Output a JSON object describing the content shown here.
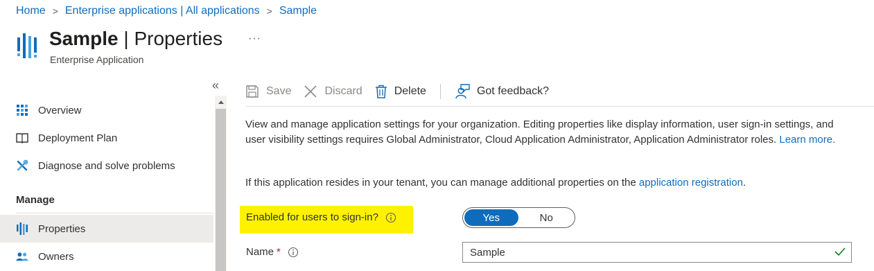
{
  "breadcrumb": {
    "items": [
      "Home",
      "Enterprise applications | All applications",
      "Sample"
    ],
    "separator": ">"
  },
  "header": {
    "app_name": "Sample",
    "title_divider": " | ",
    "page": "Properties",
    "subtitle": "Enterprise Application",
    "more": "···"
  },
  "sidebar": {
    "collapse": "«",
    "items": [
      {
        "label": "Overview",
        "icon": "overview-grid-icon"
      },
      {
        "label": "Deployment Plan",
        "icon": "book-icon"
      },
      {
        "label": "Diagnose and solve problems",
        "icon": "wrench-icon"
      }
    ],
    "section_heading": "Manage",
    "manage_items": [
      {
        "label": "Properties",
        "icon": "properties-bars-icon",
        "selected": true
      },
      {
        "label": "Owners",
        "icon": "users-icon"
      }
    ]
  },
  "toolbar": {
    "save": "Save",
    "discard": "Discard",
    "delete": "Delete",
    "feedback": "Got feedback?"
  },
  "content": {
    "description": "View and manage application settings for your organization. Editing properties like display information, user sign-in settings, and user visibility settings requires Global Administrator, Cloud Application Administrator, Application Administrator roles.",
    "learn_more": "Learn more.",
    "tenant_info_prefix": "If this application resides in your tenant, you can manage additional properties on the",
    "tenant_info_link": "application registration",
    "tenant_info_suffix": "."
  },
  "form": {
    "enabled_label": "Enabled for users to sign-in?",
    "enabled_options": [
      "Yes",
      "No"
    ],
    "enabled_value": "Yes",
    "name_label": "Name",
    "required_marker": "*",
    "name_value": "Sample"
  },
  "colors": {
    "accent": "#0f6cbd",
    "highlight": "#fff200",
    "valid_check": "#107c10",
    "required": "#a4262c"
  }
}
